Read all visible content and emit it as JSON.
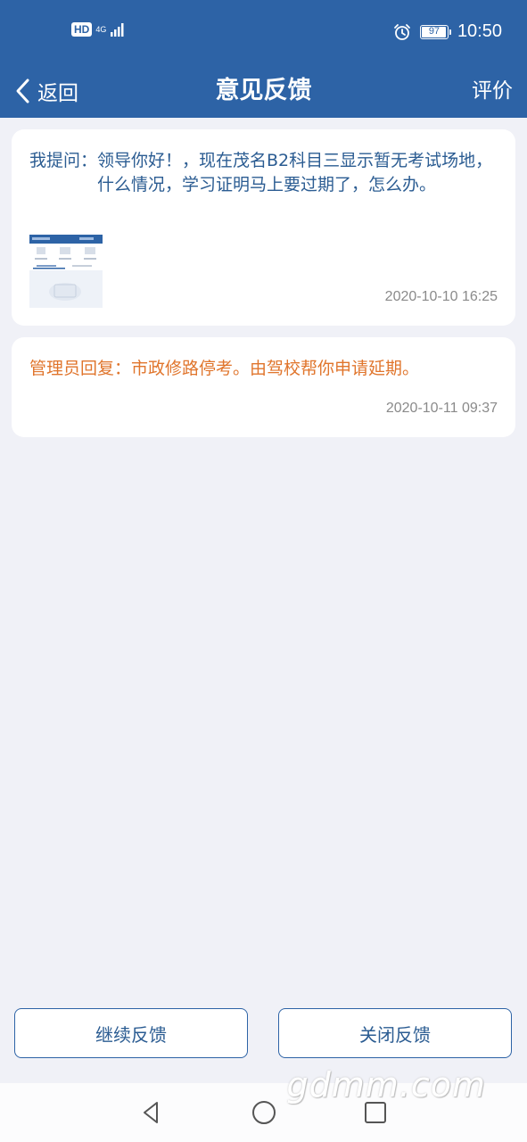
{
  "status_bar": {
    "hd_label": "HD",
    "network_label": "4G",
    "battery_level": "97",
    "battery_fraction": 0.97,
    "time": "10:50",
    "icons": [
      "hd-icon",
      "signal-icon",
      "alarm-icon",
      "battery-icon"
    ]
  },
  "nav": {
    "back_label": "返回",
    "title": "意见反馈",
    "rate_label": "评价"
  },
  "question": {
    "prefix": "我提问：",
    "text": "领导你好！，现在茂名B2科目三显示暂无考试场地，什么情况，学习证明马上要过期了，怎么办。",
    "timestamp": "2020-10-10 16:25"
  },
  "reply": {
    "text": "管理员回复：市政修路停考。由驾校帮你申请延期。",
    "timestamp": "2020-10-11 09:37"
  },
  "actions": {
    "continue_label": "继续反馈",
    "close_label": "关闭反馈"
  },
  "watermark": "gdmm.com",
  "colors": {
    "primary": "#2d63a6",
    "question_text": "#2b5c92",
    "reply_text": "#e0752c",
    "background": "#f0f1f7"
  }
}
